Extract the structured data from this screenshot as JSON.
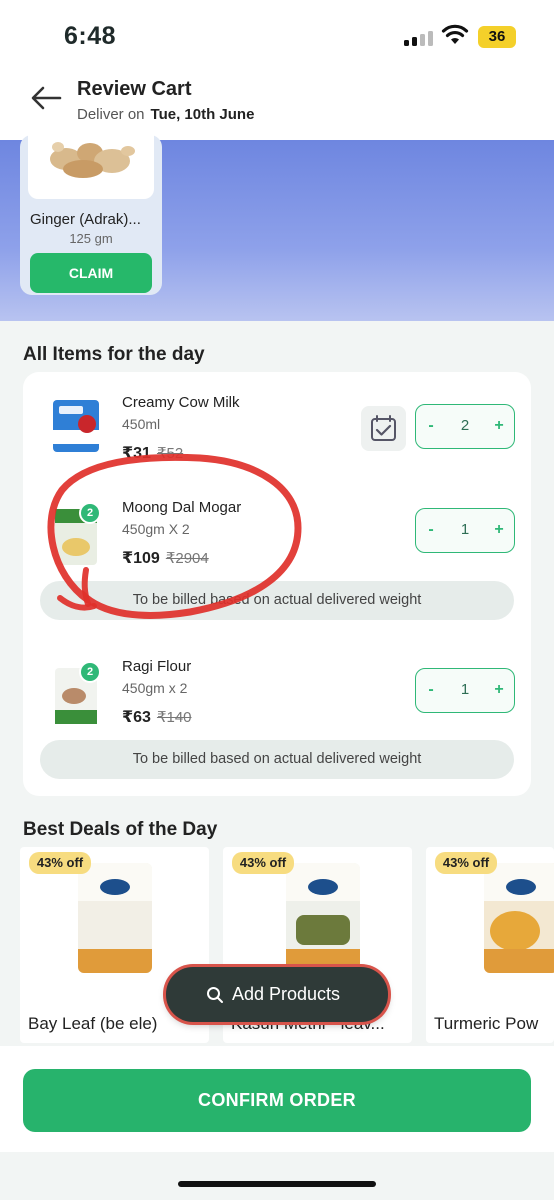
{
  "status_bar": {
    "time": "6:48",
    "battery": "36"
  },
  "header": {
    "title": "Review Cart",
    "deliver_label": "Deliver on",
    "deliver_date": "Tue, 10th June"
  },
  "promo": {
    "product_name": "Ginger (Adrak)...",
    "product_qty": "125 gm",
    "claim_label": "CLAIM"
  },
  "items_section": {
    "title": "All Items for the day",
    "items": [
      {
        "name": "Creamy Cow Milk",
        "weight": "450ml",
        "price": "₹31",
        "mrp": "₹52",
        "quantity": "2",
        "pack_badge": ""
      },
      {
        "name": "Moong Dal Mogar",
        "weight": "450gm X 2",
        "price": "₹109",
        "mrp": "₹2904",
        "quantity": "1",
        "pack_badge": "2",
        "note": "To be billed based on actual delivered weight"
      },
      {
        "name": "Ragi Flour",
        "weight": "450gm x 2",
        "price": "₹63",
        "mrp": "₹140",
        "quantity": "1",
        "pack_badge": "2",
        "note": "To be billed based on actual delivered weight"
      }
    ],
    "stepper_minus": "-",
    "stepper_plus": "+"
  },
  "deals_section": {
    "title": "Best Deals of the Day",
    "deals": [
      {
        "discount": "43% off",
        "name": "Bay Leaf (be ele)"
      },
      {
        "discount": "43% off",
        "name": "Kasuri Methi - leav..."
      },
      {
        "discount": "43% off",
        "name": "Turmeric Pow"
      }
    ]
  },
  "add_products_label": "Add Products",
  "confirm_label": "CONFIRM ORDER",
  "colors": {
    "accent_green": "#27b36c",
    "promo_blue": "#7a8fe6",
    "annotation_red": "#e0302a",
    "deal_badge": "#f7dc80"
  }
}
